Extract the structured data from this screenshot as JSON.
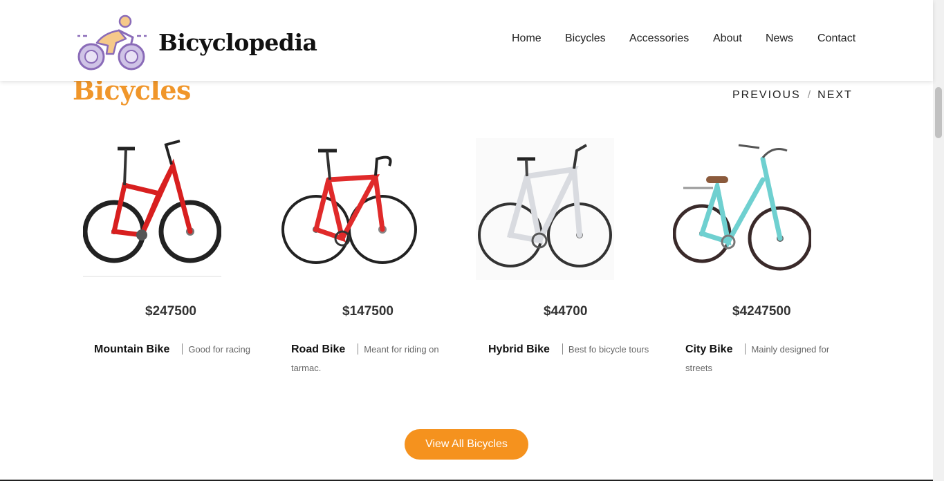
{
  "header": {
    "brand": "Bicyclopedia",
    "nav": [
      "Home",
      "Bicycles",
      "Accessories",
      "About",
      "News",
      "Contact"
    ]
  },
  "section": {
    "title": "Bicycles",
    "pager": {
      "previous": "PREVIOUS",
      "separator": "/",
      "next": "NEXT"
    }
  },
  "products": [
    {
      "name": "Mountain Bike",
      "price": "$247500",
      "desc": "Good for racing",
      "frame": "#d81f1f"
    },
    {
      "name": "Road Bike",
      "price": "$147500",
      "desc": "Meant for riding on tarmac.",
      "frame": "#e02a2a"
    },
    {
      "name": "Hybrid Bike",
      "price": "$44700",
      "desc": "Best fo bicycle tours",
      "frame": "#d9dbe0"
    },
    {
      "name": "City Bike",
      "price": "$4247500",
      "desc": "Mainly designed for streets",
      "frame": "#6fd0d0"
    }
  ],
  "cta": {
    "label": "View All Bicycles"
  },
  "colors": {
    "accent": "#f0962a",
    "button": "#f5921e"
  }
}
